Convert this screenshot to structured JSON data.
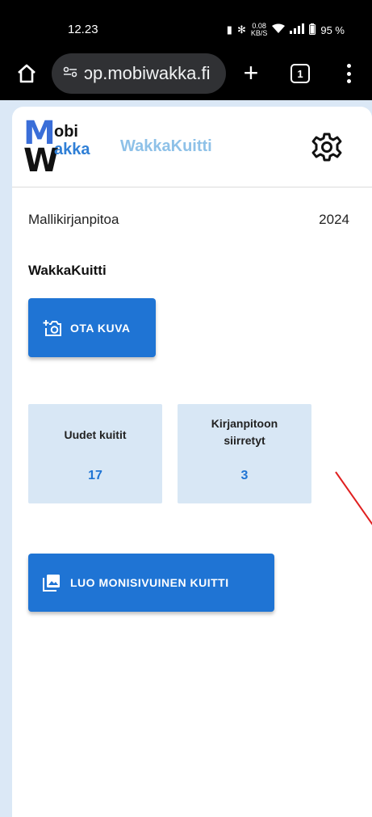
{
  "status_bar": {
    "time": "12.23",
    "speed": "0.08",
    "speed_unit": "KB/S",
    "battery": "95 %"
  },
  "browser": {
    "url": "ɔp.mobiwakka.fi",
    "tab_count": "1",
    "icons": [
      "home-icon",
      "site-settings-icon",
      "new-tab-icon",
      "tabs-icon",
      "menu-icon"
    ]
  },
  "app": {
    "logo": {
      "m": "M",
      "obi": "obi",
      "w": "W",
      "akka": "akka"
    },
    "title": "WakkaKuitti",
    "accent_color": "#1f74d4",
    "title_color": "#8ec1e8",
    "stat_bg_color": "#d8e7f5"
  },
  "main": {
    "company": "Mallikirjanpitoa",
    "year": "2024",
    "section_title": "WakkaKuitti",
    "camera_button": "OTA KUVA",
    "multipage_button": "LUO MONISIVUINEN KUITTI",
    "stats": [
      {
        "label": "Uudet kuitit",
        "value": "17"
      },
      {
        "label": "Kirjanpitoon siirretyt",
        "value": "3"
      }
    ]
  }
}
